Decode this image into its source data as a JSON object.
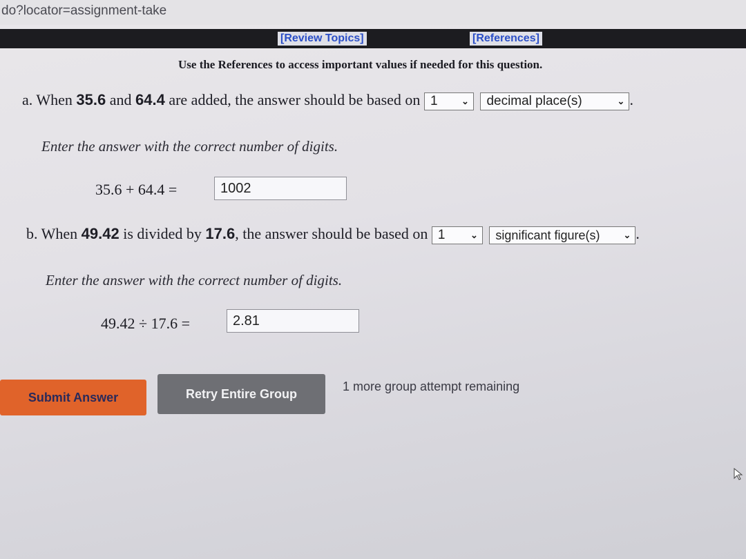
{
  "browser": {
    "url_text": "do?locator=assignment-take"
  },
  "topbar": {
    "review_topics": "[Review Topics]",
    "references": "[References]"
  },
  "instruction": "Use the References to access important values if needed for this question.",
  "part_a": {
    "prefix": "a. When ",
    "num1": "35.6",
    "mid": " and ",
    "num2": "64.4",
    "suffix": " are added, the answer should be based on ",
    "count_select": "1",
    "unit_select": "decimal place(s)",
    "end": ".",
    "hint": "Enter the answer with the correct number of digits.",
    "equation": "35.6 + 64.4 =",
    "answer_value": "1002"
  },
  "part_b": {
    "prefix": "b. When ",
    "num1": "49.42",
    "mid": " is divided by ",
    "num2": "17.6",
    "suffix": ", the answer should be based on ",
    "count_select": "1",
    "unit_select": "significant figure(s)",
    "end": ".",
    "hint": "Enter the answer with the correct number of digits.",
    "equation": "49.42 ÷ 17.6 =",
    "answer_value": "2.81"
  },
  "buttons": {
    "submit": "Submit Answer",
    "retry": "Retry Entire Group"
  },
  "attempts_text": "1 more group attempt remaining",
  "colors": {
    "submit_button": "#e0632a",
    "retry_button": "#6e6f74",
    "link": "#2b4fc7",
    "topbar": "#1c1c20"
  },
  "icons": {
    "select_chevron": "chevron-down-icon",
    "cursor": "mouse-pointer-icon"
  }
}
